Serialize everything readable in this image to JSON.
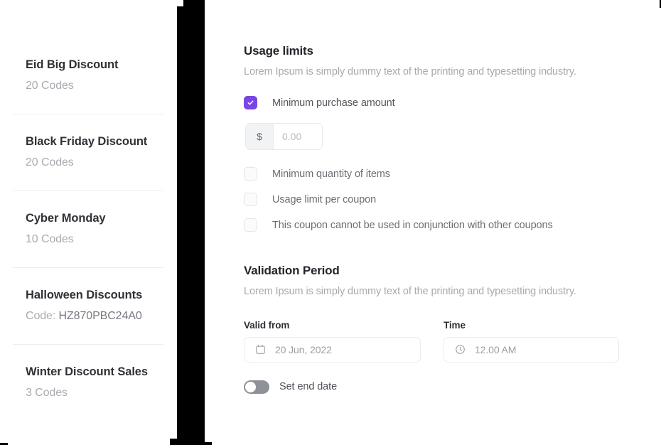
{
  "sidebar": {
    "coupons": [
      {
        "title": "Eid Big Discount",
        "sub_prefix": "",
        "sub_value": "20 Codes"
      },
      {
        "title": "Black Friday Discount",
        "sub_prefix": "",
        "sub_value": "20 Codes"
      },
      {
        "title": "Cyber Monday",
        "sub_prefix": "",
        "sub_value": "10 Codes"
      },
      {
        "title": "Halloween Discounts",
        "sub_prefix": "Code: ",
        "sub_value": "HZ870PBC24A0"
      },
      {
        "title": "Winter Discount Sales",
        "sub_prefix": "",
        "sub_value": "3 Codes"
      }
    ]
  },
  "usage_limits": {
    "title": "Usage limits",
    "description": "Lorem Ipsum is simply dummy text of the printing and typesetting industry.",
    "options": [
      {
        "label": "Minimum purchase amount",
        "checked": true
      },
      {
        "label": "Minimum quantity of items",
        "checked": false
      },
      {
        "label": "Usage limit per coupon",
        "checked": false
      },
      {
        "label": "This coupon cannot be used in conjunction with other coupons",
        "checked": false
      }
    ],
    "amount": {
      "currency_symbol": "$",
      "value": "",
      "placeholder": "0.00"
    }
  },
  "validation_period": {
    "title": "Validation Period",
    "description": "Lorem Ipsum is simply dummy text of the printing and typesetting industry.",
    "valid_from": {
      "label": "Valid from",
      "value": "20 Jun, 2022",
      "icon": "calendar-icon"
    },
    "time": {
      "label": "Time",
      "value": "12.00 AM",
      "icon": "clock-icon"
    },
    "set_end_date": {
      "label": "Set end date",
      "enabled": false
    }
  },
  "colors": {
    "accent": "#7a45e5",
    "divider_bar": "#000000",
    "heading": "#23262b",
    "muted_text": "#a7a9ae"
  }
}
